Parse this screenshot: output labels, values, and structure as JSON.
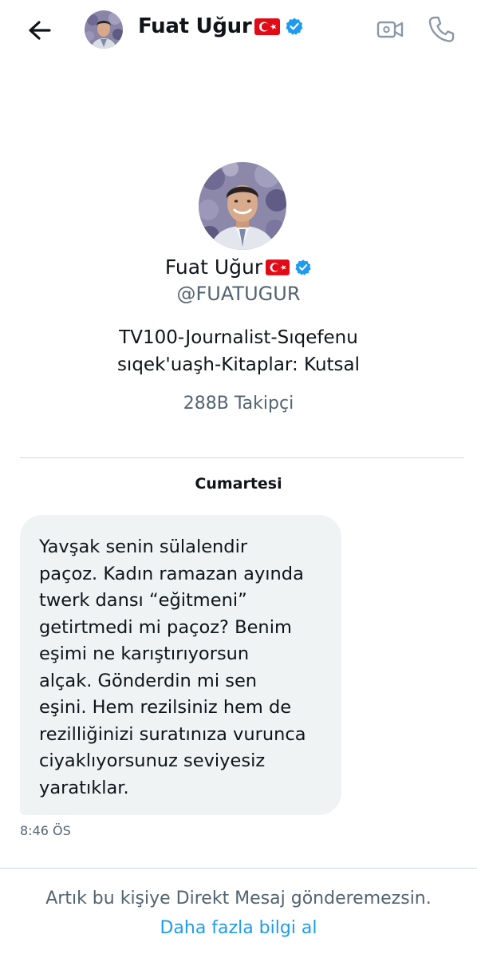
{
  "header": {
    "name": "Fuat Uğur",
    "back_icon": "arrow-left-icon",
    "video_icon": "video-camera-icon",
    "call_icon": "phone-icon"
  },
  "profile": {
    "name": "Fuat Uğur",
    "handle": "@FUATUGUR",
    "bio_line1": "TV100-Journalist-Sıqefenu",
    "bio_line2": "sıqek'uaşh-Kitaplar: Kutsal",
    "followers": "288B Takipçi"
  },
  "conversation": {
    "date_label": "Cumartesi",
    "messages": [
      {
        "text": "Yavşak senin sülalendir\npaçoz. Kadın ramazan ayında\ntwerk dansı “eğitmeni”\ngetirtmedi mi  paçoz? Benim\neşimi ne karıştırıyorsun\nalçak. Gönderdin mi sen\neşini. Hem rezilsiniz hem de\nrezilliğinizi suratınıza vurunca\nciyaklıyorsunuz seviyesiz\nyaratıklar.",
        "time": "8:46 ÖS"
      }
    ]
  },
  "footer": {
    "notice": "Artık bu kişiye Direkt Mesaj gönderemezsin.",
    "learn_more": "Daha fazla bilgi al"
  },
  "colors": {
    "accent": "#1d9bf0",
    "secondary_text": "#536471",
    "bubble_bg": "#eff3f4",
    "divider": "#cfd9de"
  }
}
